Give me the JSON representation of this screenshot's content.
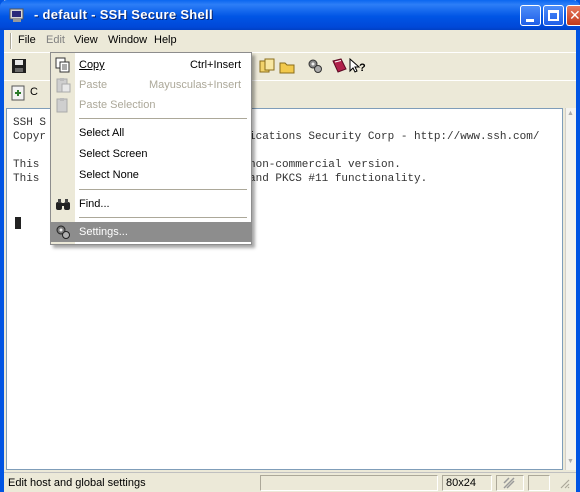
{
  "window": {
    "title": "- default - SSH Secure Shell"
  },
  "menubar": {
    "items": [
      {
        "label": "File"
      },
      {
        "label": "Edit"
      },
      {
        "label": "View"
      },
      {
        "label": "Window"
      },
      {
        "label": "Help"
      }
    ]
  },
  "toolbar2": {
    "profile_label": "C"
  },
  "edit_menu": {
    "items": [
      {
        "label": "Copy",
        "shortcut": "Ctrl+Insert",
        "icon": "copy-icon",
        "enabled": true
      },
      {
        "label": "Paste",
        "shortcut": "Mayusculas+Insert",
        "icon": "paste-icon",
        "enabled": false
      },
      {
        "label": "Paste Selection",
        "shortcut": "",
        "icon": "paste-selection-icon",
        "enabled": false
      },
      {
        "label": "Select All",
        "shortcut": "",
        "enabled": true
      },
      {
        "label": "Select Screen",
        "shortcut": "",
        "enabled": true
      },
      {
        "label": "Select None",
        "shortcut": "",
        "enabled": true
      },
      {
        "label": "Find...",
        "shortcut": "",
        "icon": "binoculars-icon",
        "enabled": true
      },
      {
        "label": "Settings...",
        "shortcut": "",
        "icon": "settings-gears-icon",
        "enabled": true,
        "highlighted": true
      }
    ]
  },
  "terminal": {
    "lines": [
      {
        "left": "SSH S",
        "right": ""
      },
      {
        "left": "Copyr",
        "right": "ications Security Corp - http://www.ssh.com/"
      },
      {
        "left": "",
        "right": ""
      },
      {
        "left": "This",
        "right": "non-commercial version."
      },
      {
        "left": "This",
        "right": "and PKCS #11 functionality."
      }
    ]
  },
  "statusbar": {
    "text": "Edit host and global settings",
    "size": "80x24"
  },
  "colors": {
    "titlebar": "#0055e5",
    "highlight": "#8d8d8d"
  }
}
